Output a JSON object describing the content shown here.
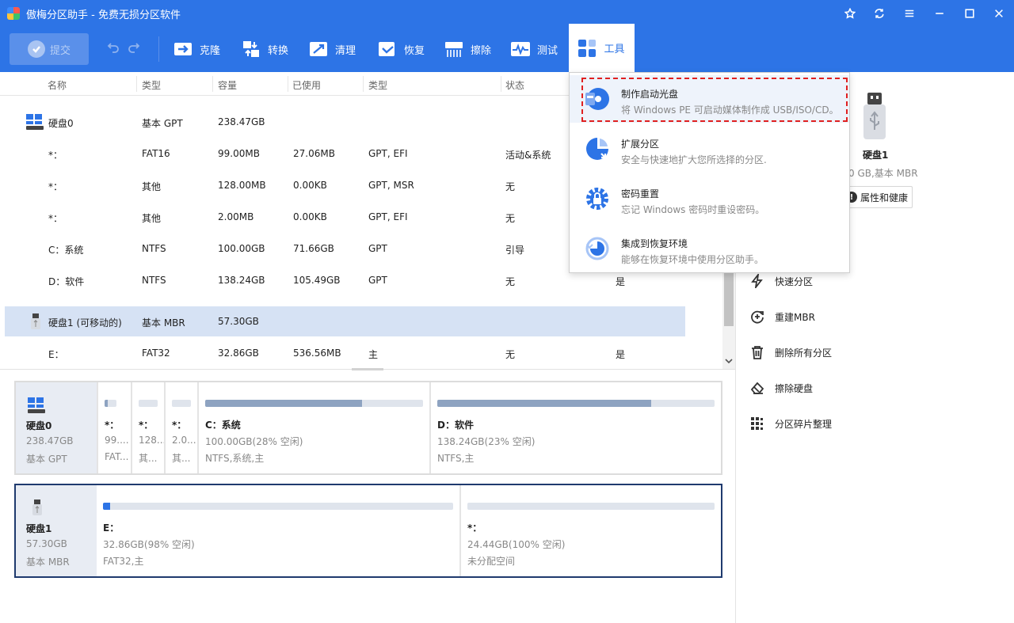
{
  "titlebar": {
    "title": "傲梅分区助手 - 免费无损分区软件"
  },
  "toolbar": {
    "commit": "提交",
    "tools": [
      "克隆",
      "转换",
      "清理",
      "恢复",
      "擦除",
      "测试"
    ],
    "active_tool": "工具"
  },
  "table": {
    "headers": [
      "名称",
      "类型",
      "容量",
      "已使用",
      "类型",
      "状态"
    ],
    "rows": [
      {
        "name": "硬盘0",
        "type": "基本 GPT",
        "capacity": "238.47GB",
        "used": "",
        "ptype": "",
        "status": "",
        "extra": ""
      },
      {
        "name": "*：",
        "type": "FAT16",
        "capacity": "99.00MB",
        "used": "27.06MB",
        "ptype": "GPT, EFI",
        "status": "活动&系统",
        "extra": ""
      },
      {
        "name": "*：",
        "type": "其他",
        "capacity": "128.00MB",
        "used": "0.00KB",
        "ptype": "GPT, MSR",
        "status": "无",
        "extra": ""
      },
      {
        "name": "*：",
        "type": "其他",
        "capacity": "2.00MB",
        "used": "0.00KB",
        "ptype": "GPT, EFI",
        "status": "无",
        "extra": ""
      },
      {
        "name": "C：系统",
        "type": "NTFS",
        "capacity": "100.00GB",
        "used": "71.66GB",
        "ptype": "GPT",
        "status": "引导",
        "extra": ""
      },
      {
        "name": "D：软件",
        "type": "NTFS",
        "capacity": "138.24GB",
        "used": "105.49GB",
        "ptype": "GPT",
        "status": "无",
        "extra": "是"
      },
      {
        "name": "硬盘1 (可移动的)",
        "type": "基本 MBR",
        "capacity": "57.30GB",
        "used": "",
        "ptype": "",
        "status": "",
        "extra": ""
      },
      {
        "name": "E：",
        "type": "FAT32",
        "capacity": "32.86GB",
        "used": "536.56MB",
        "ptype": "主",
        "status": "无",
        "extra": "是"
      }
    ]
  },
  "diskmap": {
    "disk0": {
      "name": "硬盘0",
      "size": "238.47GB",
      "type": "基本 GPT",
      "parts": [
        {
          "name": "*：",
          "info": "99....",
          "fs": "FAT...",
          "used_pct": 27
        },
        {
          "name": "*：",
          "info": "128....",
          "fs": "其...",
          "used_pct": 0
        },
        {
          "name": "*：",
          "info": "2.0...",
          "fs": "其...",
          "used_pct": 0
        },
        {
          "name": "C：系统",
          "info": "100.00GB(28% 空闲)",
          "fs": "NTFS,系统,主",
          "used_pct": 72
        },
        {
          "name": "D：软件",
          "info": "138.24GB(23% 空闲)",
          "fs": "NTFS,主",
          "used_pct": 77
        }
      ]
    },
    "disk1": {
      "name": "硬盘1",
      "size": "57.30GB",
      "type": "基本 MBR",
      "parts": [
        {
          "name": "E：",
          "info": "32.86GB(98% 空闲)",
          "fs": "FAT32,主",
          "used_pct": 2
        },
        {
          "name": "*：",
          "info": "24.44GB(100% 空闲)",
          "fs": "未分配空间",
          "used_pct": 0
        }
      ]
    }
  },
  "rightpanel": {
    "disk_name": "硬盘1",
    "disk_sub": "0 GB,基本 MBR",
    "props_button": "属性和健康",
    "ops": [
      "快速分区",
      "重建MBR",
      "删除所有分区",
      "擦除硬盘",
      "分区碎片整理"
    ]
  },
  "dropdown": {
    "items": [
      {
        "title": "制作启动光盘",
        "desc": "将 Windows PE 可启动媒体制作成 USB/ISO/CD。"
      },
      {
        "title": "扩展分区",
        "desc": "安全与快速地扩大您所选择的分区."
      },
      {
        "title": "密码重置",
        "desc": "忘记 Windows 密码时重设密码。"
      },
      {
        "title": "集成到恢复环境",
        "desc": "能够在恢复环境中使用分区助手。"
      }
    ]
  },
  "colors": {
    "accent": "#2d74e6",
    "selection": "#d6e2f4",
    "highlight_border": "#e02020"
  }
}
